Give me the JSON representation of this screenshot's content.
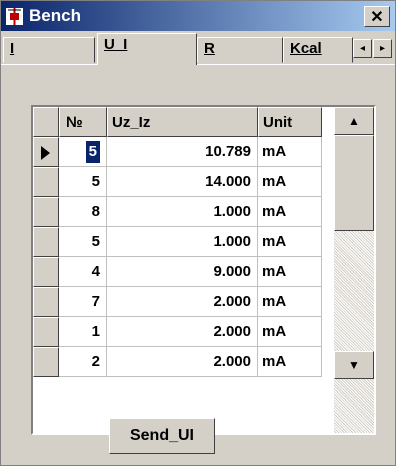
{
  "window": {
    "title": "Bench",
    "close_glyph": "✕"
  },
  "tabs": [
    {
      "label": "I",
      "active": false
    },
    {
      "label": "U_I",
      "active": true
    },
    {
      "label": "R",
      "active": false
    },
    {
      "label": "Kcal",
      "active": false
    }
  ],
  "tab_scroll": {
    "left_glyph": "◂",
    "right_glyph": "▸"
  },
  "grid": {
    "columns": [
      "№",
      "Uz_Iz",
      "Unit"
    ],
    "rows": [
      {
        "num": "5",
        "value": "10.789",
        "unit": "mA",
        "selected": true
      },
      {
        "num": "5",
        "value": "14.000",
        "unit": "mA"
      },
      {
        "num": "8",
        "value": "1.000",
        "unit": "mA"
      },
      {
        "num": "5",
        "value": "1.000",
        "unit": "mA"
      },
      {
        "num": "4",
        "value": "9.000",
        "unit": "mA"
      },
      {
        "num": "7",
        "value": "2.000",
        "unit": "mA"
      },
      {
        "num": "1",
        "value": "2.000",
        "unit": "mA"
      },
      {
        "num": "2",
        "value": "2.000",
        "unit": "mA"
      }
    ]
  },
  "scrollbar": {
    "up_glyph": "▲",
    "down_glyph": "▼"
  },
  "buttons": {
    "send_label": "Send_UI"
  },
  "colors": {
    "titlebar_start": "#0a246a",
    "titlebar_end": "#a6caf0",
    "face": "#d4d0c8",
    "selection": "#0a246a"
  },
  "icons": {
    "app": "resistor-app-icon"
  }
}
